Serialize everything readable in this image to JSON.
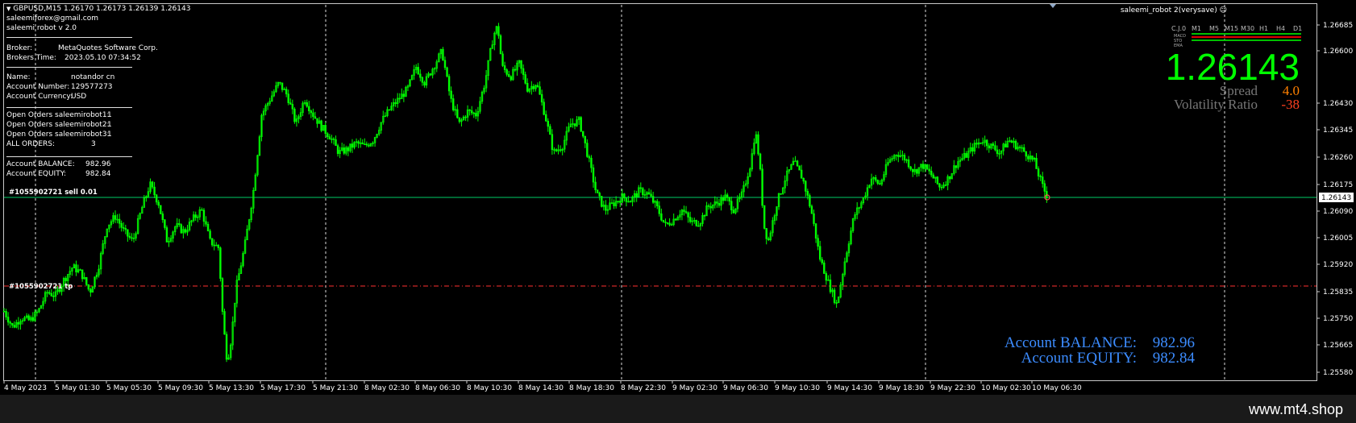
{
  "header": {
    "symbol_line": "GBPUSD,M15  1.26170 1.26173 1.26139 1.26143",
    "email": "saleemiforex@gmail.com",
    "version": "saleemi robot v 2.0",
    "ea_title": "saleemi_robot 2(verysave)"
  },
  "info_panel": {
    "broker_label": "Broker:",
    "broker_value": "MetaQuotes Software Corp.",
    "time_label": "Brokers Time:",
    "time_value": "2023.05.10 07:34:52",
    "name_label": "Name:",
    "name_value": "notandor cn",
    "account_label": "Account Number:",
    "account_value": "129577273",
    "currency_label": "Account Currency:",
    "currency_value": "USD",
    "orders": [
      {
        "label": "Open Orders saleemirobot1:",
        "value": "1"
      },
      {
        "label": "Open Orders saleemirobot2:",
        "value": "1"
      },
      {
        "label": "Open Orders saleemirobot3:",
        "value": "1"
      },
      {
        "label": "ALL ORDERS:",
        "value": "3"
      }
    ],
    "balance_label": "Account BALANCE:",
    "balance_value": "982.96",
    "equity_label": "Account EQUITY:",
    "equity_value": "982.84"
  },
  "order_lines": {
    "sell_label": "#1055902721 sell 0.01",
    "tp_label": "#1055902721 tp"
  },
  "price_panel": {
    "big_price": "1.26143",
    "spread_label": "Spread",
    "spread_value": "4.0",
    "vol_label": "Volatility Ratio",
    "vol_value": "-38",
    "timeframes": [
      "C.J.0",
      "M1",
      "M5",
      "M15",
      "M30",
      "H1",
      "H4",
      "D1"
    ],
    "indicators": [
      "MACD",
      "STO",
      "EMA"
    ]
  },
  "bottom_panel": {
    "balance_label": "Account BALANCE:",
    "balance_value": "982.96",
    "equity_label": "Account EQUITY:",
    "equity_value": "982.84"
  },
  "price_axis": {
    "labels": [
      "1.26685",
      "1.26600",
      "1.26430",
      "1.26345",
      "1.26260",
      "1.26175",
      "1.26090",
      "1.26005",
      "1.25920",
      "1.25835",
      "1.25750",
      "1.25665",
      "1.25580"
    ],
    "current": "1.26143"
  },
  "time_axis": {
    "labels": [
      "4 May 2023",
      "5 May 01:30",
      "5 May 05:30",
      "5 May 09:30",
      "5 May 13:30",
      "5 May 17:30",
      "5 May 21:30",
      "8 May 02:30",
      "8 May 06:30",
      "8 May 10:30",
      "8 May 14:30",
      "8 May 18:30",
      "8 May 22:30",
      "9 May 02:30",
      "9 May 06:30",
      "9 May 10:30",
      "9 May 14:30",
      "9 May 18:30",
      "9 May 22:30",
      "10 May 02:30",
      "10 May 06:30"
    ]
  },
  "watermark": "www.mt4.shop",
  "colors": {
    "candle": "#00ff00",
    "price_line": "#00cc66",
    "tp_line": "#ff3030",
    "big_price": "#00ff00",
    "spread_value": "#ff8000",
    "vol_value": "#ff4020",
    "bottom_text": "#3c8cff"
  },
  "chart_data": {
    "type": "candlestick",
    "symbol": "GBPUSD",
    "timeframe": "M15",
    "ylim": [
      1.2558,
      1.26685
    ],
    "close_path": [
      [
        0,
        1.2578
      ],
      [
        10,
        1.2573
      ],
      [
        20,
        1.2576
      ],
      [
        30,
        1.2575
      ],
      [
        40,
        1.2578
      ],
      [
        50,
        1.2584
      ],
      [
        60,
        1.2583
      ],
      [
        70,
        1.2588
      ],
      [
        80,
        1.2592
      ],
      [
        90,
        1.259
      ],
      [
        100,
        1.2584
      ],
      [
        110,
        1.2592
      ],
      [
        120,
        1.2605
      ],
      [
        130,
        1.2608
      ],
      [
        140,
        1.2603
      ],
      [
        150,
        1.26
      ],
      [
        160,
        1.261
      ],
      [
        170,
        1.2618
      ],
      [
        180,
        1.2612
      ],
      [
        190,
        1.26
      ],
      [
        200,
        1.2605
      ],
      [
        210,
        1.2603
      ],
      [
        220,
        1.2607
      ],
      [
        230,
        1.261
      ],
      [
        240,
        1.26
      ],
      [
        250,
        1.2598
      ],
      [
        255,
        1.2575
      ],
      [
        260,
        1.2562
      ],
      [
        265,
        1.257
      ],
      [
        270,
        1.2585
      ],
      [
        280,
        1.2598
      ],
      [
        290,
        1.2615
      ],
      [
        300,
        1.264
      ],
      [
        310,
        1.2645
      ],
      [
        320,
        1.265
      ],
      [
        330,
        1.2646
      ],
      [
        340,
        1.2637
      ],
      [
        350,
        1.2645
      ],
      [
        360,
        1.264
      ],
      [
        370,
        1.2636
      ],
      [
        380,
        1.2633
      ],
      [
        390,
        1.2628
      ],
      [
        400,
        1.2629
      ],
      [
        410,
        1.2631
      ],
      [
        420,
        1.263
      ],
      [
        430,
        1.2632
      ],
      [
        440,
        1.2638
      ],
      [
        450,
        1.2642
      ],
      [
        460,
        1.2645
      ],
      [
        470,
        1.2648
      ],
      [
        480,
        1.2655
      ],
      [
        490,
        1.265
      ],
      [
        500,
        1.2655
      ],
      [
        510,
        1.266
      ],
      [
        520,
        1.2645
      ],
      [
        530,
        1.2637
      ],
      [
        540,
        1.2641
      ],
      [
        550,
        1.264
      ],
      [
        560,
        1.265
      ],
      [
        570,
        1.2665
      ],
      [
        575,
        1.2668
      ],
      [
        580,
        1.2655
      ],
      [
        590,
        1.2652
      ],
      [
        600,
        1.2656
      ],
      [
        610,
        1.2648
      ],
      [
        620,
        1.265
      ],
      [
        630,
        1.264
      ],
      [
        640,
        1.2628
      ],
      [
        650,
        1.263
      ],
      [
        660,
        1.2637
      ],
      [
        670,
        1.2638
      ],
      [
        680,
        1.2627
      ],
      [
        690,
        1.2615
      ],
      [
        700,
        1.261
      ],
      [
        710,
        1.2612
      ],
      [
        720,
        1.2614
      ],
      [
        730,
        1.2613
      ],
      [
        740,
        1.2616
      ],
      [
        750,
        1.2615
      ],
      [
        760,
        1.2611
      ],
      [
        770,
        1.2605
      ],
      [
        780,
        1.2607
      ],
      [
        790,
        1.261
      ],
      [
        800,
        1.2606
      ],
      [
        810,
        1.2606
      ],
      [
        820,
        1.2611
      ],
      [
        830,
        1.2612
      ],
      [
        840,
        1.2614
      ],
      [
        850,
        1.261
      ],
      [
        860,
        1.2615
      ],
      [
        870,
        1.2625
      ],
      [
        875,
        1.2635
      ],
      [
        880,
        1.2625
      ],
      [
        885,
        1.2605
      ],
      [
        890,
        1.26
      ],
      [
        900,
        1.2612
      ],
      [
        910,
        1.262
      ],
      [
        920,
        1.2625
      ],
      [
        930,
        1.262
      ],
      [
        940,
        1.261
      ],
      [
        950,
        1.2595
      ],
      [
        960,
        1.2587
      ],
      [
        970,
        1.258
      ],
      [
        980,
        1.2595
      ],
      [
        990,
        1.2608
      ],
      [
        1000,
        1.2613
      ],
      [
        1010,
        1.262
      ],
      [
        1020,
        1.2618
      ],
      [
        1030,
        1.2625
      ],
      [
        1040,
        1.2628
      ],
      [
        1050,
        1.2626
      ],
      [
        1060,
        1.2622
      ],
      [
        1070,
        1.2624
      ],
      [
        1080,
        1.2621
      ],
      [
        1090,
        1.2617
      ],
      [
        1100,
        1.262
      ],
      [
        1110,
        1.2625
      ],
      [
        1120,
        1.2627
      ],
      [
        1130,
        1.263
      ],
      [
        1140,
        1.2632
      ],
      [
        1150,
        1.263
      ],
      [
        1160,
        1.2628
      ],
      [
        1170,
        1.2632
      ],
      [
        1180,
        1.263
      ],
      [
        1190,
        1.2628
      ],
      [
        1200,
        1.2625
      ],
      [
        1210,
        1.2617
      ],
      [
        1215,
        1.26143
      ]
    ],
    "xlim": [
      0,
      1230
    ]
  }
}
